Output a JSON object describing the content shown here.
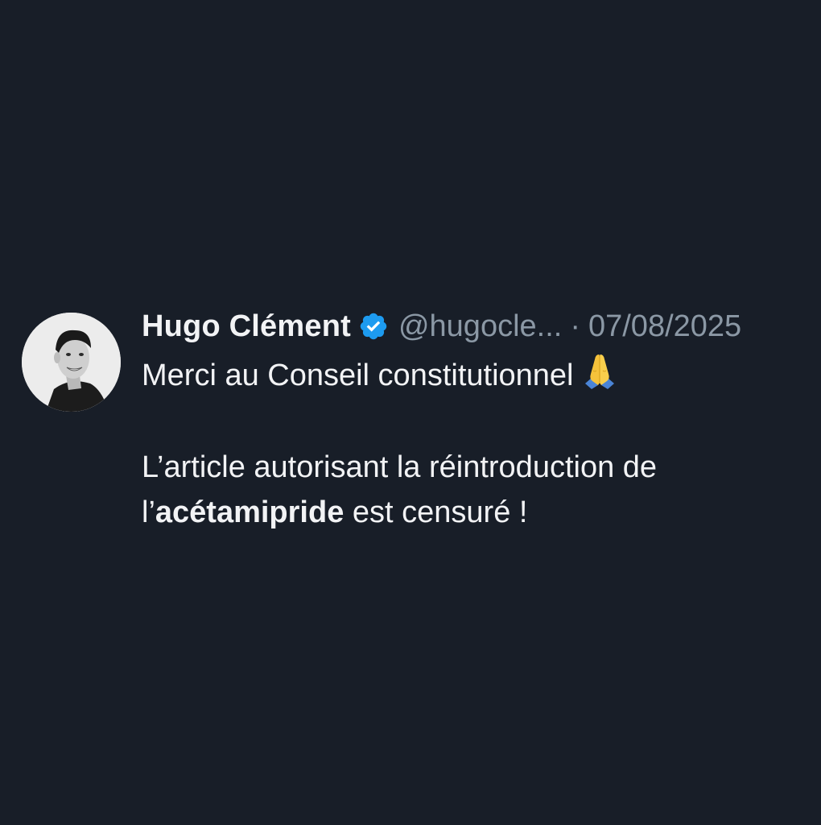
{
  "tweet": {
    "author": {
      "display_name": "Hugo Clément",
      "handle": "@hugocle...",
      "verified_icon": "verified-badge-icon",
      "avatar": "author-avatar-photo"
    },
    "separator": "·",
    "date": "07/08/2025",
    "text": {
      "line1": "Merci au Conseil constitutionnel",
      "line1_emoji": "folded-hands-emoji",
      "line2": "L’article autorisant la réintroduction de",
      "line3_prefix": "l’",
      "line3_bold": "acétamipride",
      "line3_suffix": " est censuré !"
    }
  },
  "colors": {
    "background": "#181e28",
    "text_primary": "#f2f3f5",
    "text_secondary": "#8b98a5",
    "verified_blue": "#1d9bf0"
  }
}
